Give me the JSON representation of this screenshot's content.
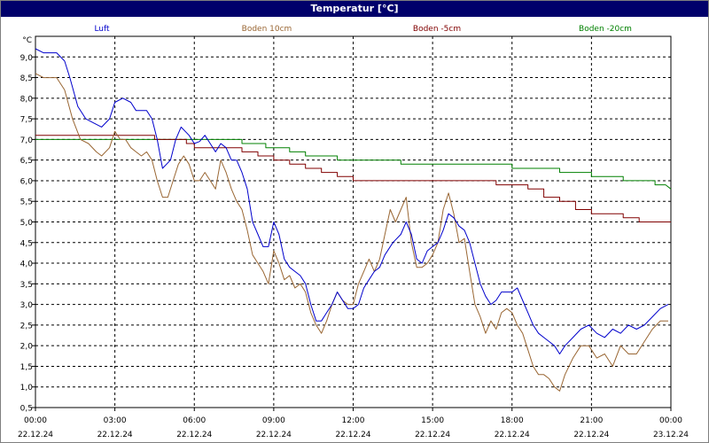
{
  "window": {
    "title": "Temperatur [°C]"
  },
  "chart_data": {
    "type": "line",
    "title": "Temperatur [°C]",
    "ylabel": "°C",
    "ylim": [
      0.5,
      9.5
    ],
    "xlim": [
      0,
      24
    ],
    "y_ticks": [
      0.5,
      1.0,
      1.5,
      2.0,
      2.5,
      3.0,
      3.5,
      4.0,
      4.5,
      5.0,
      5.5,
      6.0,
      6.5,
      7.0,
      7.5,
      8.0,
      8.5,
      9.0
    ],
    "y_tick_labels": [
      "0,5",
      "1,0",
      "1,5",
      "2,0",
      "2,5",
      "3,0",
      "3,5",
      "4,0",
      "4,5",
      "5,0",
      "5,5",
      "6,0",
      "6,5",
      "7,0",
      "7,5",
      "8,0",
      "8,5",
      "9,0"
    ],
    "x_ticks": [
      0,
      3,
      6,
      9,
      12,
      15,
      18,
      21,
      24
    ],
    "x_tick_labels": [
      {
        "time": "00:00",
        "date": "22.12.24"
      },
      {
        "time": "03:00",
        "date": "22.12.24"
      },
      {
        "time": "06:00",
        "date": "22.12.24"
      },
      {
        "time": "09:00",
        "date": "22.12.24"
      },
      {
        "time": "12:00",
        "date": "22.12.24"
      },
      {
        "time": "15:00",
        "date": "22.12.24"
      },
      {
        "time": "18:00",
        "date": "22.12.24"
      },
      {
        "time": "21:00",
        "date": "22.12.24"
      },
      {
        "time": "00:00",
        "date": "23.12.24"
      }
    ],
    "grid": true,
    "legend": "top",
    "series": [
      {
        "name": "Luft",
        "color": "#0000cc",
        "points": [
          [
            0,
            9.2
          ],
          [
            0.3,
            9.1
          ],
          [
            0.8,
            9.1
          ],
          [
            1.1,
            8.9
          ],
          [
            1.3,
            8.5
          ],
          [
            1.6,
            7.8
          ],
          [
            1.9,
            7.5
          ],
          [
            2.2,
            7.4
          ],
          [
            2.5,
            7.3
          ],
          [
            2.8,
            7.5
          ],
          [
            3.0,
            7.9
          ],
          [
            3.3,
            8.0
          ],
          [
            3.6,
            7.9
          ],
          [
            3.8,
            7.7
          ],
          [
            4.2,
            7.7
          ],
          [
            4.4,
            7.5
          ],
          [
            4.6,
            7.0
          ],
          [
            4.8,
            6.3
          ],
          [
            5.1,
            6.5
          ],
          [
            5.3,
            7.0
          ],
          [
            5.5,
            7.3
          ],
          [
            5.8,
            7.1
          ],
          [
            6.0,
            6.9
          ],
          [
            6.2,
            6.95
          ],
          [
            6.4,
            7.1
          ],
          [
            6.6,
            6.9
          ],
          [
            6.8,
            6.7
          ],
          [
            7.0,
            6.9
          ],
          [
            7.2,
            6.8
          ],
          [
            7.4,
            6.5
          ],
          [
            7.6,
            6.5
          ],
          [
            7.8,
            6.2
          ],
          [
            8.0,
            5.8
          ],
          [
            8.2,
            5.0
          ],
          [
            8.4,
            4.7
          ],
          [
            8.6,
            4.4
          ],
          [
            8.8,
            4.4
          ],
          [
            9.0,
            5.0
          ],
          [
            9.2,
            4.7
          ],
          [
            9.4,
            4.1
          ],
          [
            9.6,
            3.9
          ],
          [
            9.8,
            3.8
          ],
          [
            10.0,
            3.7
          ],
          [
            10.2,
            3.5
          ],
          [
            10.4,
            3.0
          ],
          [
            10.6,
            2.6
          ],
          [
            10.8,
            2.6
          ],
          [
            11.0,
            2.8
          ],
          [
            11.2,
            3.0
          ],
          [
            11.4,
            3.3
          ],
          [
            11.6,
            3.1
          ],
          [
            11.8,
            2.9
          ],
          [
            12.0,
            2.9
          ],
          [
            12.2,
            3.0
          ],
          [
            12.4,
            3.4
          ],
          [
            12.6,
            3.6
          ],
          [
            12.8,
            3.8
          ],
          [
            13.0,
            3.9
          ],
          [
            13.2,
            4.2
          ],
          [
            13.5,
            4.5
          ],
          [
            13.8,
            4.7
          ],
          [
            14.0,
            5.0
          ],
          [
            14.2,
            4.7
          ],
          [
            14.4,
            4.1
          ],
          [
            14.6,
            4.0
          ],
          [
            14.8,
            4.3
          ],
          [
            15.0,
            4.4
          ],
          [
            15.2,
            4.5
          ],
          [
            15.4,
            4.8
          ],
          [
            15.6,
            5.2
          ],
          [
            15.8,
            5.1
          ],
          [
            16.0,
            4.9
          ],
          [
            16.2,
            4.8
          ],
          [
            16.4,
            4.5
          ],
          [
            16.6,
            4.0
          ],
          [
            16.8,
            3.5
          ],
          [
            17.0,
            3.2
          ],
          [
            17.2,
            3.0
          ],
          [
            17.4,
            3.1
          ],
          [
            17.6,
            3.3
          ],
          [
            17.8,
            3.3
          ],
          [
            18.0,
            3.3
          ],
          [
            18.2,
            3.4
          ],
          [
            18.4,
            3.1
          ],
          [
            18.6,
            2.8
          ],
          [
            18.8,
            2.5
          ],
          [
            19.0,
            2.3
          ],
          [
            19.2,
            2.2
          ],
          [
            19.4,
            2.1
          ],
          [
            19.6,
            2.0
          ],
          [
            19.8,
            1.8
          ],
          [
            20.0,
            2.0
          ],
          [
            20.3,
            2.2
          ],
          [
            20.6,
            2.4
          ],
          [
            20.9,
            2.5
          ],
          [
            21.2,
            2.3
          ],
          [
            21.5,
            2.2
          ],
          [
            21.8,
            2.4
          ],
          [
            22.1,
            2.3
          ],
          [
            22.4,
            2.5
          ],
          [
            22.7,
            2.4
          ],
          [
            23.0,
            2.5
          ],
          [
            23.3,
            2.7
          ],
          [
            23.6,
            2.9
          ],
          [
            23.9,
            3.0
          ]
        ]
      },
      {
        "name": "Boden 10cm",
        "color": "#996633",
        "points": [
          [
            0,
            8.6
          ],
          [
            0.3,
            8.5
          ],
          [
            0.8,
            8.5
          ],
          [
            1.1,
            8.2
          ],
          [
            1.4,
            7.5
          ],
          [
            1.7,
            7.0
          ],
          [
            2.0,
            6.9
          ],
          [
            2.3,
            6.7
          ],
          [
            2.5,
            6.6
          ],
          [
            2.8,
            6.8
          ],
          [
            3.0,
            7.2
          ],
          [
            3.2,
            7.0
          ],
          [
            3.4,
            7.0
          ],
          [
            3.6,
            6.8
          ],
          [
            3.8,
            6.7
          ],
          [
            4.0,
            6.6
          ],
          [
            4.2,
            6.7
          ],
          [
            4.4,
            6.5
          ],
          [
            4.6,
            6.0
          ],
          [
            4.8,
            5.6
          ],
          [
            5.0,
            5.6
          ],
          [
            5.2,
            6.0
          ],
          [
            5.4,
            6.4
          ],
          [
            5.6,
            6.6
          ],
          [
            5.8,
            6.4
          ],
          [
            6.0,
            6.0
          ],
          [
            6.2,
            6.0
          ],
          [
            6.4,
            6.2
          ],
          [
            6.6,
            6.0
          ],
          [
            6.8,
            5.8
          ],
          [
            7.0,
            6.5
          ],
          [
            7.2,
            6.2
          ],
          [
            7.4,
            5.8
          ],
          [
            7.6,
            5.5
          ],
          [
            7.8,
            5.3
          ],
          [
            8.0,
            4.8
          ],
          [
            8.2,
            4.2
          ],
          [
            8.4,
            4.0
          ],
          [
            8.6,
            3.8
          ],
          [
            8.8,
            3.5
          ],
          [
            9.0,
            4.3
          ],
          [
            9.2,
            4.0
          ],
          [
            9.4,
            3.6
          ],
          [
            9.6,
            3.7
          ],
          [
            9.8,
            3.4
          ],
          [
            10.0,
            3.5
          ],
          [
            10.2,
            3.3
          ],
          [
            10.4,
            2.8
          ],
          [
            10.6,
            2.5
          ],
          [
            10.8,
            2.3
          ],
          [
            11.0,
            2.6
          ],
          [
            11.2,
            3.0
          ],
          [
            11.4,
            3.3
          ],
          [
            11.6,
            3.1
          ],
          [
            11.8,
            3.0
          ],
          [
            12.0,
            3.0
          ],
          [
            12.2,
            3.5
          ],
          [
            12.4,
            3.8
          ],
          [
            12.6,
            4.1
          ],
          [
            12.8,
            3.8
          ],
          [
            13.0,
            4.1
          ],
          [
            13.2,
            4.7
          ],
          [
            13.4,
            5.3
          ],
          [
            13.6,
            5.0
          ],
          [
            13.8,
            5.3
          ],
          [
            14.0,
            5.6
          ],
          [
            14.2,
            4.5
          ],
          [
            14.4,
            3.9
          ],
          [
            14.6,
            3.9
          ],
          [
            14.8,
            4.0
          ],
          [
            15.0,
            4.2
          ],
          [
            15.2,
            4.5
          ],
          [
            15.4,
            5.3
          ],
          [
            15.6,
            5.7
          ],
          [
            15.8,
            5.2
          ],
          [
            16.0,
            4.5
          ],
          [
            16.2,
            4.6
          ],
          [
            16.4,
            3.8
          ],
          [
            16.6,
            3.0
          ],
          [
            16.8,
            2.7
          ],
          [
            17.0,
            2.3
          ],
          [
            17.2,
            2.6
          ],
          [
            17.4,
            2.4
          ],
          [
            17.6,
            2.8
          ],
          [
            17.8,
            2.9
          ],
          [
            18.0,
            2.8
          ],
          [
            18.2,
            2.5
          ],
          [
            18.4,
            2.3
          ],
          [
            18.6,
            1.9
          ],
          [
            18.8,
            1.5
          ],
          [
            19.0,
            1.3
          ],
          [
            19.2,
            1.3
          ],
          [
            19.4,
            1.2
          ],
          [
            19.6,
            1.0
          ],
          [
            19.8,
            0.9
          ],
          [
            20.0,
            1.3
          ],
          [
            20.3,
            1.7
          ],
          [
            20.6,
            2.0
          ],
          [
            20.9,
            2.0
          ],
          [
            21.2,
            1.7
          ],
          [
            21.5,
            1.8
          ],
          [
            21.8,
            1.5
          ],
          [
            22.1,
            2.0
          ],
          [
            22.4,
            1.8
          ],
          [
            22.7,
            1.8
          ],
          [
            23.0,
            2.1
          ],
          [
            23.3,
            2.4
          ],
          [
            23.6,
            2.6
          ],
          [
            23.9,
            2.6
          ]
        ]
      },
      {
        "name": "Boden -5cm",
        "color": "#800000",
        "points": [
          [
            0,
            7.1
          ],
          [
            4.5,
            7.1
          ],
          [
            4.5,
            7.0
          ],
          [
            5.7,
            7.0
          ],
          [
            5.7,
            6.9
          ],
          [
            6.0,
            6.9
          ],
          [
            6.0,
            6.8
          ],
          [
            7.8,
            6.8
          ],
          [
            7.8,
            6.7
          ],
          [
            8.4,
            6.7
          ],
          [
            8.4,
            6.6
          ],
          [
            9.0,
            6.6
          ],
          [
            9.0,
            6.5
          ],
          [
            9.6,
            6.5
          ],
          [
            9.6,
            6.4
          ],
          [
            10.2,
            6.4
          ],
          [
            10.2,
            6.3
          ],
          [
            10.8,
            6.3
          ],
          [
            10.8,
            6.2
          ],
          [
            11.4,
            6.2
          ],
          [
            11.4,
            6.1
          ],
          [
            12.0,
            6.1
          ],
          [
            12.0,
            6.0
          ],
          [
            17.4,
            6.0
          ],
          [
            17.4,
            5.9
          ],
          [
            18.6,
            5.9
          ],
          [
            18.6,
            5.8
          ],
          [
            19.2,
            5.8
          ],
          [
            19.2,
            5.6
          ],
          [
            19.8,
            5.6
          ],
          [
            19.8,
            5.5
          ],
          [
            20.4,
            5.5
          ],
          [
            20.4,
            5.3
          ],
          [
            21.0,
            5.3
          ],
          [
            21.0,
            5.2
          ],
          [
            22.2,
            5.2
          ],
          [
            22.2,
            5.1
          ],
          [
            22.8,
            5.1
          ],
          [
            22.8,
            5.0
          ],
          [
            24,
            5.0
          ]
        ]
      },
      {
        "name": "Boden -20cm",
        "color": "#008000",
        "points": [
          [
            0,
            7.0
          ],
          [
            7.8,
            7.0
          ],
          [
            7.8,
            6.9
          ],
          [
            8.7,
            6.9
          ],
          [
            8.7,
            6.8
          ],
          [
            9.6,
            6.8
          ],
          [
            9.6,
            6.7
          ],
          [
            10.2,
            6.7
          ],
          [
            10.2,
            6.6
          ],
          [
            11.4,
            6.6
          ],
          [
            11.4,
            6.5
          ],
          [
            13.8,
            6.5
          ],
          [
            13.8,
            6.4
          ],
          [
            18.0,
            6.4
          ],
          [
            18.0,
            6.3
          ],
          [
            19.8,
            6.3
          ],
          [
            19.8,
            6.2
          ],
          [
            21.0,
            6.2
          ],
          [
            21.0,
            6.1
          ],
          [
            22.2,
            6.1
          ],
          [
            22.2,
            6.0
          ],
          [
            23.4,
            6.0
          ],
          [
            23.4,
            5.9
          ],
          [
            23.8,
            5.9
          ],
          [
            24,
            5.8
          ]
        ]
      }
    ]
  }
}
